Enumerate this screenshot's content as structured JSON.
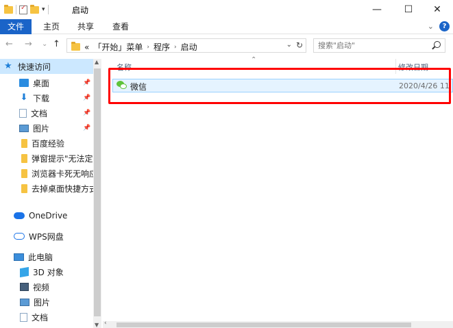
{
  "window": {
    "title": "启动",
    "minimize": "—",
    "maximize": "☐",
    "close": "✕"
  },
  "ribbon": {
    "tabs": [
      "文件",
      "主页",
      "共享",
      "查看"
    ],
    "help": "?",
    "collapse": "⌄"
  },
  "address": {
    "back": "←",
    "forward": "→",
    "recent": "⌄",
    "up": "↑",
    "overflow": "«",
    "crumbs": [
      "「开始」菜单",
      "程序",
      "启动"
    ],
    "dropdown": "⌄",
    "refresh": "↻"
  },
  "search": {
    "placeholder": "搜索\"启动\""
  },
  "nav_pane": {
    "items": [
      {
        "label": "快速访问",
        "icon": "star-icon",
        "pinned": false,
        "selected": true
      },
      {
        "label": "桌面",
        "icon": "desktop-icon",
        "pinned": true
      },
      {
        "label": "下载",
        "icon": "download-icon",
        "pinned": true
      },
      {
        "label": "文档",
        "icon": "document-icon",
        "pinned": true
      },
      {
        "label": "图片",
        "icon": "pictures-icon",
        "pinned": true
      },
      {
        "label": "百度经验",
        "icon": "folder-icon",
        "pinned": false
      },
      {
        "label": "弹窗提示\"无法定",
        "icon": "folder-icon",
        "pinned": false
      },
      {
        "label": "浏览器卡死无响应",
        "icon": "folder-icon",
        "pinned": false
      },
      {
        "label": "去掉桌面快捷方式",
        "icon": "folder-icon",
        "pinned": false
      },
      {
        "label": "OneDrive",
        "icon": "onedrive-icon",
        "pinned": false
      },
      {
        "label": "WPS网盘",
        "icon": "wps-cloud-icon",
        "pinned": false
      },
      {
        "label": "此电脑",
        "icon": "this-pc-icon",
        "pinned": false
      },
      {
        "label": "3D 对象",
        "icon": "3d-objects-icon",
        "pinned": false
      },
      {
        "label": "视频",
        "icon": "video-icon",
        "pinned": false
      },
      {
        "label": "图片",
        "icon": "pictures-icon",
        "pinned": false
      },
      {
        "label": "文档",
        "icon": "document-icon",
        "pinned": false
      }
    ]
  },
  "columns": {
    "name": "名称",
    "modified": "修改日期"
  },
  "files": [
    {
      "name": "微信",
      "modified": "2020/4/26 11",
      "icon": "wechat-icon"
    }
  ],
  "colors": {
    "accent": "#1a64c8",
    "highlight_box": "#ff0000",
    "selection": "#cce8ff"
  }
}
